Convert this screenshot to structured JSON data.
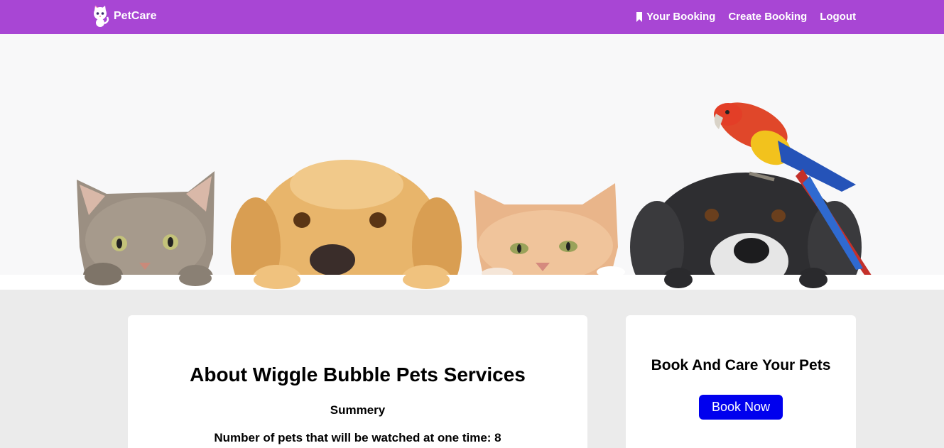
{
  "navbar": {
    "brand": "PetCare",
    "logo_icon": "cat-logo-icon",
    "links": [
      {
        "label": "Your Booking",
        "icon": "bookmark-icon"
      },
      {
        "label": "Create Booking"
      },
      {
        "label": "Logout"
      }
    ],
    "color": "#a846d4"
  },
  "hero": {
    "image": "pets-peeking-banner"
  },
  "about": {
    "title": "About Wiggle Bubble Pets Services",
    "summary": "Summery",
    "pets_count": "Number of pets that will be watched at one time: 8"
  },
  "booking": {
    "title": "Book And Care Your Pets",
    "button": "Book Now",
    "button_color": "#0000ee"
  }
}
